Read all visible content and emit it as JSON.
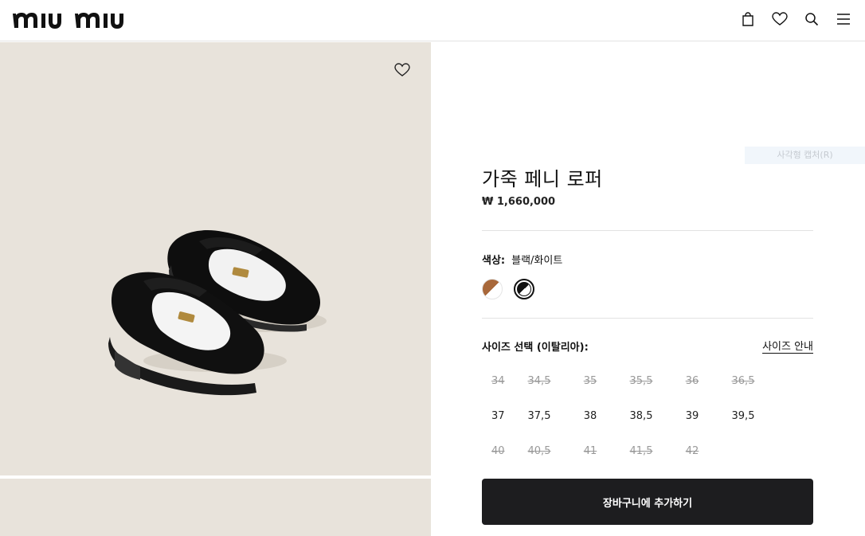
{
  "brand": {
    "logo_text": "miu miu"
  },
  "header": {
    "icons": [
      "shopping-bag-icon",
      "heart-icon",
      "search-icon",
      "menu-icon"
    ]
  },
  "overlay": {
    "capture_text": "사각형 캡처(R)"
  },
  "product": {
    "title": "가죽 페니 로퍼",
    "price": "₩ 1,660,000",
    "color_label": "색상:",
    "color_value": "블랙/화이트",
    "swatches": [
      {
        "name": "brown-white",
        "colors": [
          "#a8683a",
          "#ffffff"
        ],
        "selected": false
      },
      {
        "name": "black-white",
        "colors": [
          "#111111",
          "#ffffff"
        ],
        "selected": true
      }
    ],
    "size_heading": "사이즈 선택 (이탈리아):",
    "size_guide": "사이즈 안내",
    "sizes": [
      [
        {
          "label": "34",
          "available": false
        },
        {
          "label": "34,5",
          "available": false
        },
        {
          "label": "35",
          "available": false
        },
        {
          "label": "35,5",
          "available": false
        },
        {
          "label": "36",
          "available": false
        },
        {
          "label": "36,5",
          "available": false
        }
      ],
      [
        {
          "label": "37",
          "available": true
        },
        {
          "label": "37,5",
          "available": true
        },
        {
          "label": "38",
          "available": true
        },
        {
          "label": "38,5",
          "available": true
        },
        {
          "label": "39",
          "available": true
        },
        {
          "label": "39,5",
          "available": true
        }
      ],
      [
        {
          "label": "40",
          "available": false
        },
        {
          "label": "40,5",
          "available": false
        },
        {
          "label": "41",
          "available": false
        },
        {
          "label": "41,5",
          "available": false
        },
        {
          "label": "42",
          "available": false
        }
      ]
    ],
    "add_to_cart": "장바구니에 추가하기"
  },
  "colors": {
    "image_bg": "#e8e3db",
    "button_bg": "#1d1d1f",
    "divider": "#e2e2e2"
  }
}
